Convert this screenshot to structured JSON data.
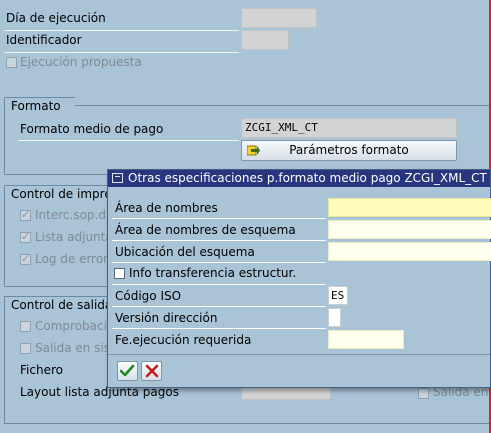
{
  "main": {
    "dia_ejecucion_label": "Día de ejecución",
    "dia_ejecucion_value": "",
    "identificador_label": "Identificador",
    "identificador_value": "",
    "ejecucion_propuesta_label": "Ejecución propuesta"
  },
  "formato": {
    "title": "Formato",
    "medio_pago_label": "Formato medio de pago",
    "medio_pago_value": "ZCGI_XML_CT",
    "params_button_label": "Parámetros formato"
  },
  "control_impresion": {
    "title": "Control de impres",
    "items": [
      "Interc.sop.da",
      "Lista adjunta",
      "Log de errore"
    ]
  },
  "control_salida": {
    "title": "Control de salida",
    "comprobacion_label": "Comprobació",
    "salida_sistema_label": "Salida en siste",
    "fichero_label": "Fichero",
    "layout_label": "Layout lista adjunta pagos",
    "salida_right_label": "Salida en p"
  },
  "dialog": {
    "title": "Otras especificaciones p.formato medio pago ZCGI_XML_CT",
    "area_nombres_label": "Área de nombres",
    "area_nombres_value": "",
    "area_esquema_label": "Área de nombres de esquema",
    "area_esquema_value": "",
    "ubicacion_label": "Ubicación del esquema",
    "ubicacion_value": "",
    "info_transferencia_label": "Info transferencia estructur.",
    "codigo_iso_label": "Código ISO",
    "codigo_iso_value": "ES",
    "version_label": "Versión dirección",
    "version_value": "",
    "fe_ejecucion_label": "Fe.ejecución requerida",
    "fe_ejecucion_value": ""
  },
  "colors": {
    "background": "#a9c3d7",
    "title_bar": "#27367e",
    "required_field": "#fdfdb9"
  },
  "icons": {
    "params_button": "arrow-icon",
    "confirm": "checkmark-icon",
    "cancel": "cross-icon"
  }
}
